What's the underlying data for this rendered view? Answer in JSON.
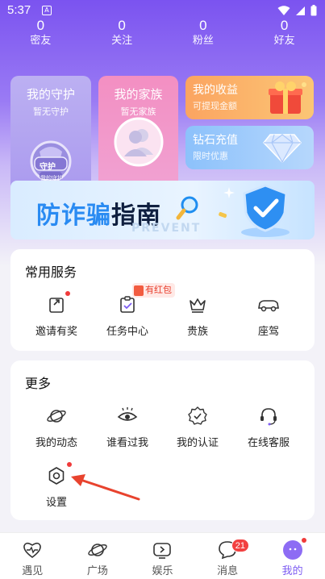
{
  "status": {
    "time": "5:37",
    "notif": "A"
  },
  "stats": [
    {
      "num": "0",
      "label": "密友"
    },
    {
      "num": "0",
      "label": "关注"
    },
    {
      "num": "0",
      "label": "粉丝"
    },
    {
      "num": "0",
      "label": "好友"
    }
  ],
  "cards": {
    "guard": {
      "title": "我的守护",
      "sub": "暂无守护",
      "medal_text": "守护",
      "medal_sub": "我的守护"
    },
    "family": {
      "title": "我的家族",
      "sub": "暂无家族"
    },
    "income": {
      "title": "我的收益",
      "sub": "可提现金额"
    },
    "diamond": {
      "title": "钻石充值",
      "sub": "限时优惠"
    }
  },
  "banner": {
    "part1": "防诈骗",
    "part2": "指南",
    "faint": "PREVENT"
  },
  "common": {
    "title": "常用服务",
    "hongbao": "有红包",
    "items": [
      {
        "label": "邀请有奖",
        "icon": "invite-icon"
      },
      {
        "label": "任务中心",
        "icon": "task-icon"
      },
      {
        "label": "贵族",
        "icon": "crown-icon"
      },
      {
        "label": "座驾",
        "icon": "car-icon"
      }
    ]
  },
  "more": {
    "title": "更多",
    "items": [
      {
        "label": "我的动态",
        "icon": "planet-icon"
      },
      {
        "label": "谁看过我",
        "icon": "eye-icon"
      },
      {
        "label": "我的认证",
        "icon": "badge-check-icon"
      },
      {
        "label": "在线客服",
        "icon": "headset-icon"
      },
      {
        "label": "设置",
        "icon": "settings-icon"
      }
    ]
  },
  "tabs": [
    {
      "label": "遇见",
      "icon": "heart-pulse-icon"
    },
    {
      "label": "广场",
      "icon": "planet-icon"
    },
    {
      "label": "娱乐",
      "icon": "play-icon"
    },
    {
      "label": "消息",
      "icon": "chat-icon",
      "badge": "21"
    },
    {
      "label": "我的",
      "icon": "profile-icon"
    }
  ],
  "colors": {
    "accent": "#7d5cf2",
    "red": "#f03a3a"
  }
}
